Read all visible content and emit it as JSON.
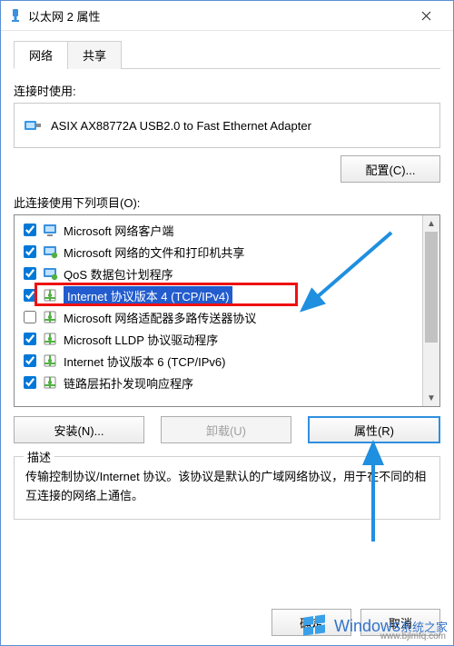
{
  "window": {
    "title": "以太网 2 属性"
  },
  "tabs": {
    "network": "网络",
    "sharing": "共享"
  },
  "labels": {
    "connectUsing": "连接时使用:",
    "itemsUsed": "此连接使用下列项目(O):",
    "descTitle": "描述",
    "descText": "传输控制协议/Internet 协议。该协议是默认的广域网络协议，用于在不同的相互连接的网络上通信。"
  },
  "adapter": {
    "name": "ASIX AX88772A USB2.0 to Fast Ethernet Adapter"
  },
  "buttons": {
    "configure": "配置(C)...",
    "install": "安装(N)...",
    "uninstall": "卸载(U)",
    "properties": "属性(R)",
    "ok": "确定",
    "cancel": "取消"
  },
  "items": [
    {
      "checked": true,
      "icon": "client",
      "label": "Microsoft 网络客户端"
    },
    {
      "checked": true,
      "icon": "service",
      "label": "Microsoft 网络的文件和打印机共享"
    },
    {
      "checked": true,
      "icon": "service",
      "label": "QoS 数据包计划程序"
    },
    {
      "checked": true,
      "icon": "proto",
      "label": "Internet 协议版本 4 (TCP/IPv4)",
      "selected": true
    },
    {
      "checked": false,
      "icon": "proto",
      "label": "Microsoft 网络适配器多路传送器协议"
    },
    {
      "checked": true,
      "icon": "proto",
      "label": "Microsoft LLDP 协议驱动程序"
    },
    {
      "checked": true,
      "icon": "proto",
      "label": "Internet 协议版本 6 (TCP/IPv6)"
    },
    {
      "checked": true,
      "icon": "proto",
      "label": "链路层拓扑发现响应程序"
    }
  ],
  "watermark": {
    "brand": "Windows",
    "sub": "系统之家",
    "url": "www.bjlmfq.com"
  }
}
